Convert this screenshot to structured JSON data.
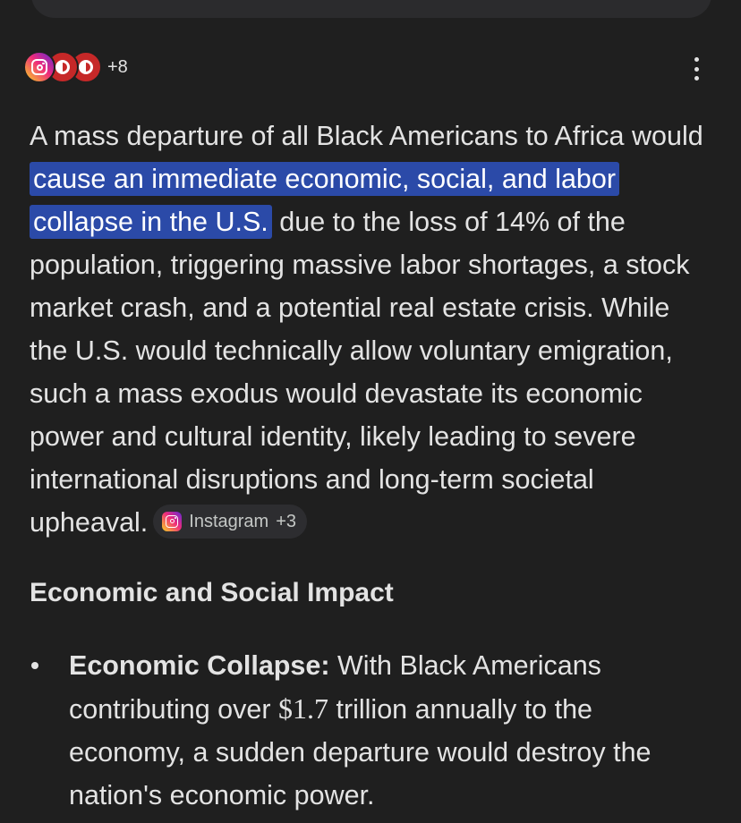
{
  "sources": {
    "favicons": [
      "instagram-icon",
      "red-circle-icon",
      "red-circle-icon"
    ],
    "more_count": "+8"
  },
  "menu": {
    "icon": "more-vertical-icon"
  },
  "answer": {
    "lead": "A mass departure of all Black Americans to Africa would",
    "highlight": "cause an immediate economic, social, and labor collapse in the U.S.",
    "rest": "due to the loss of 14% of the population, triggering massive labor shortages, a stock market crash, and a potential real estate crisis. While the U.S. would technically allow voluntary emigration, such a mass exodus would devastate its economic power and cultural identity, likely leading to severe international disruptions and long-term societal upheaval.",
    "citation_chip": {
      "source": "Instagram",
      "count": "+3"
    }
  },
  "section": {
    "heading": "Economic and Social Impact",
    "bullets": [
      {
        "term": "Economic Collapse:",
        "text_before": "With Black Americans contributing over",
        "amount": "$1.7",
        "text_after": "trillion annually to the economy, a sudden departure would destroy the nation's economic power."
      }
    ]
  },
  "colors": {
    "background": "#1f1f1f",
    "text": "#e3e3e3",
    "highlight": "#2b4aa8",
    "chip_background": "#2d2d30",
    "top_card": "#2b2b2d"
  }
}
